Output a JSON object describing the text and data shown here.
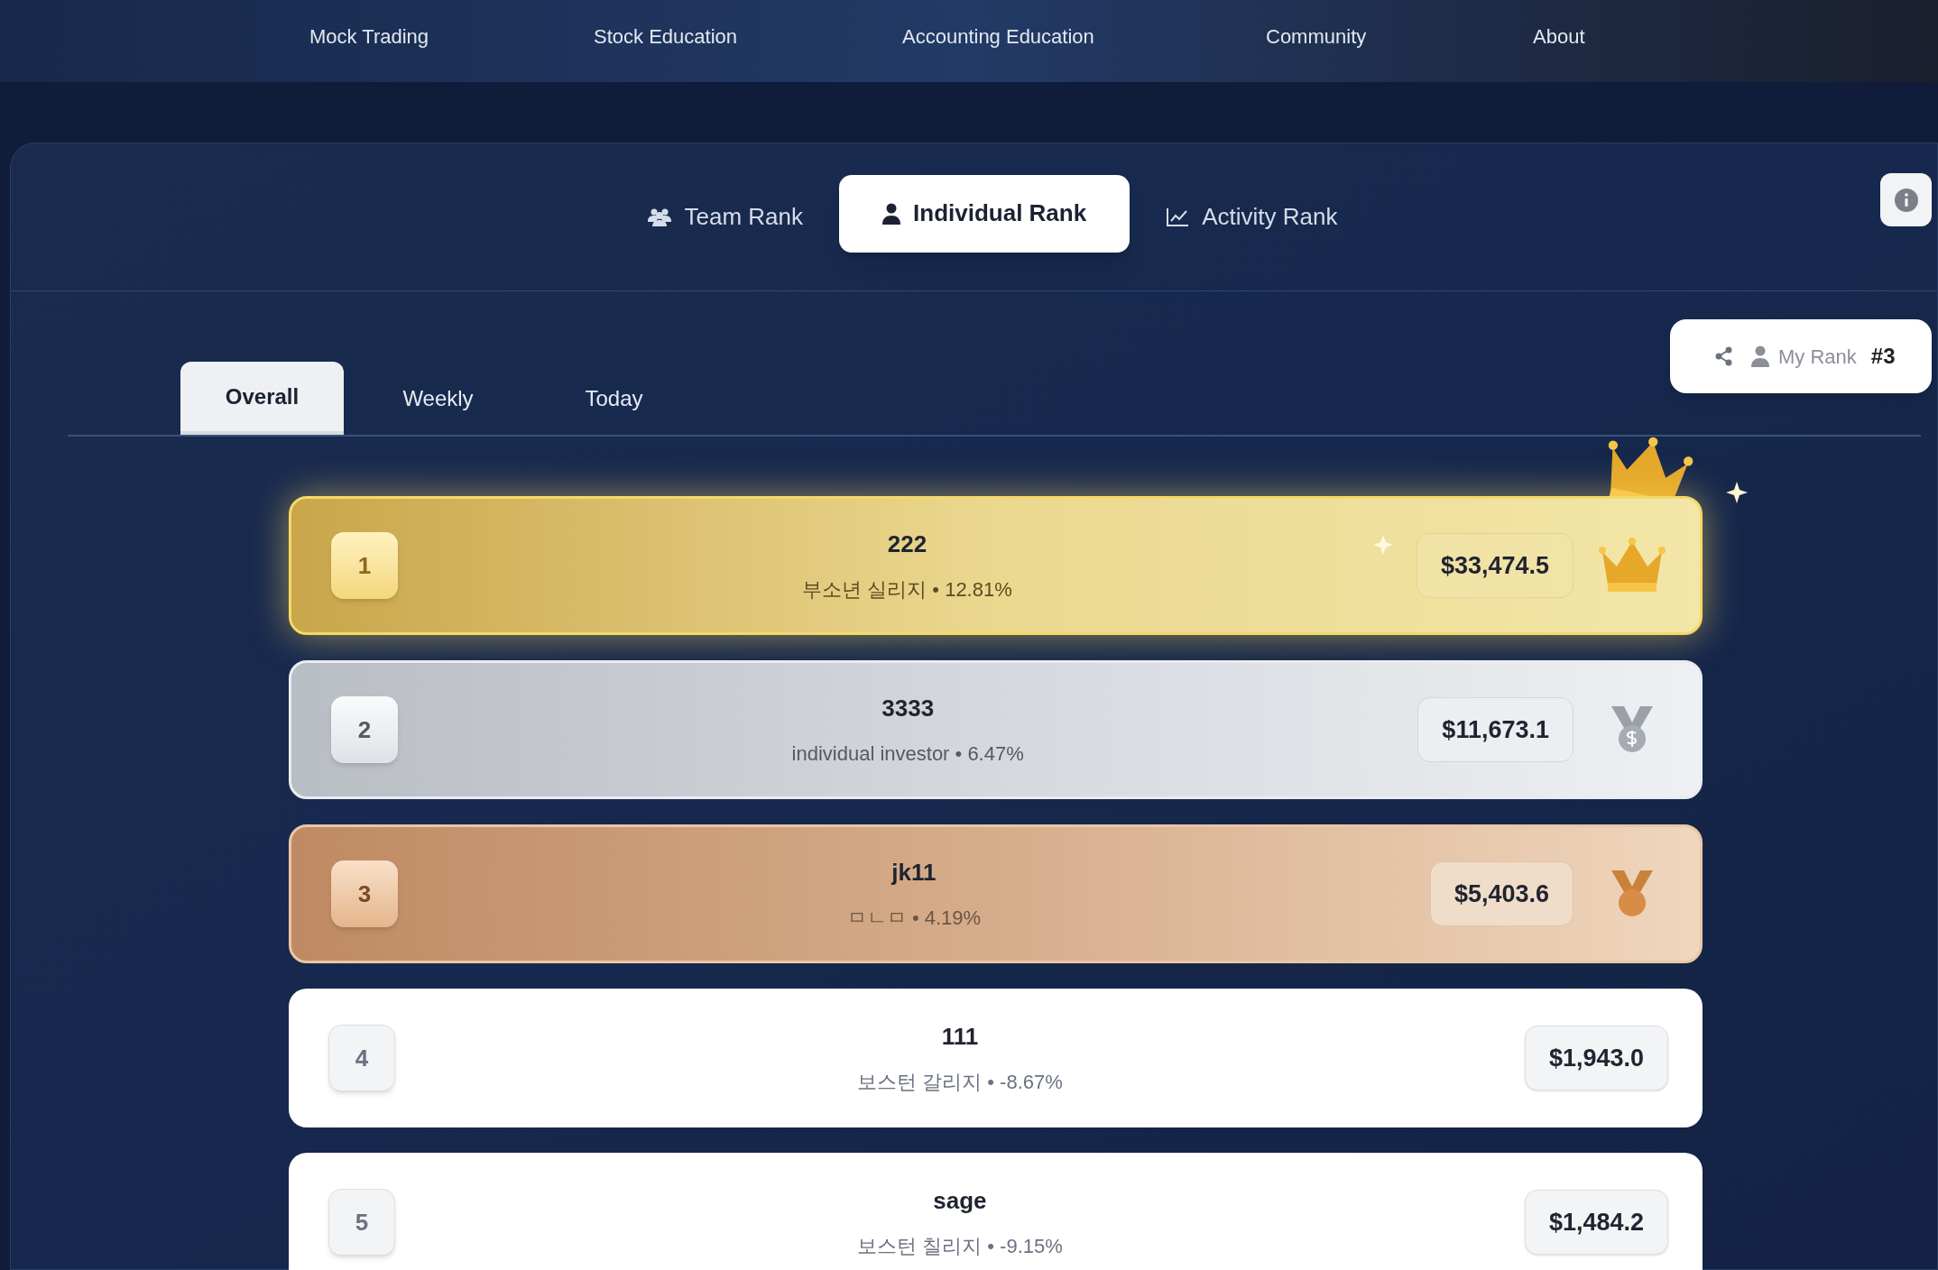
{
  "nav": [
    {
      "label": "Mock Trading"
    },
    {
      "label": "Stock Education"
    },
    {
      "label": "Accounting Education"
    },
    {
      "label": "Community"
    },
    {
      "label": "About"
    }
  ],
  "rank_tabs": [
    {
      "label": "Team Rank",
      "kind": "team",
      "selected": false
    },
    {
      "label": "Individual Rank",
      "kind": "person",
      "selected": true
    },
    {
      "label": "Activity Rank",
      "kind": "chart",
      "selected": false
    }
  ],
  "my_rank": {
    "label": "My Rank",
    "value": "#3"
  },
  "period_tabs": [
    {
      "label": "Overall",
      "selected": true
    },
    {
      "label": "Weekly",
      "selected": false
    },
    {
      "label": "Today",
      "selected": false
    }
  ],
  "rows": [
    {
      "rank": "1",
      "name": "222",
      "subtitle": "부소년 실리지 • 12.81%",
      "value": "$33,474.5",
      "kind": "gold"
    },
    {
      "rank": "2",
      "name": "3333",
      "subtitle": "individual investor • 6.47%",
      "value": "$11,673.1",
      "kind": "silver"
    },
    {
      "rank": "3",
      "name": "jk11",
      "subtitle": "ㅁㄴㅁ • 4.19%",
      "value": "$5,403.6",
      "kind": "bronze"
    },
    {
      "rank": "4",
      "name": "111",
      "subtitle": "보스턴 갈리지 • -8.67%",
      "value": "$1,943.0",
      "kind": "plain"
    },
    {
      "rank": "5",
      "name": "sage",
      "subtitle": "보스턴 칠리지 • -9.15%",
      "value": "$1,484.2",
      "kind": "plain"
    }
  ]
}
